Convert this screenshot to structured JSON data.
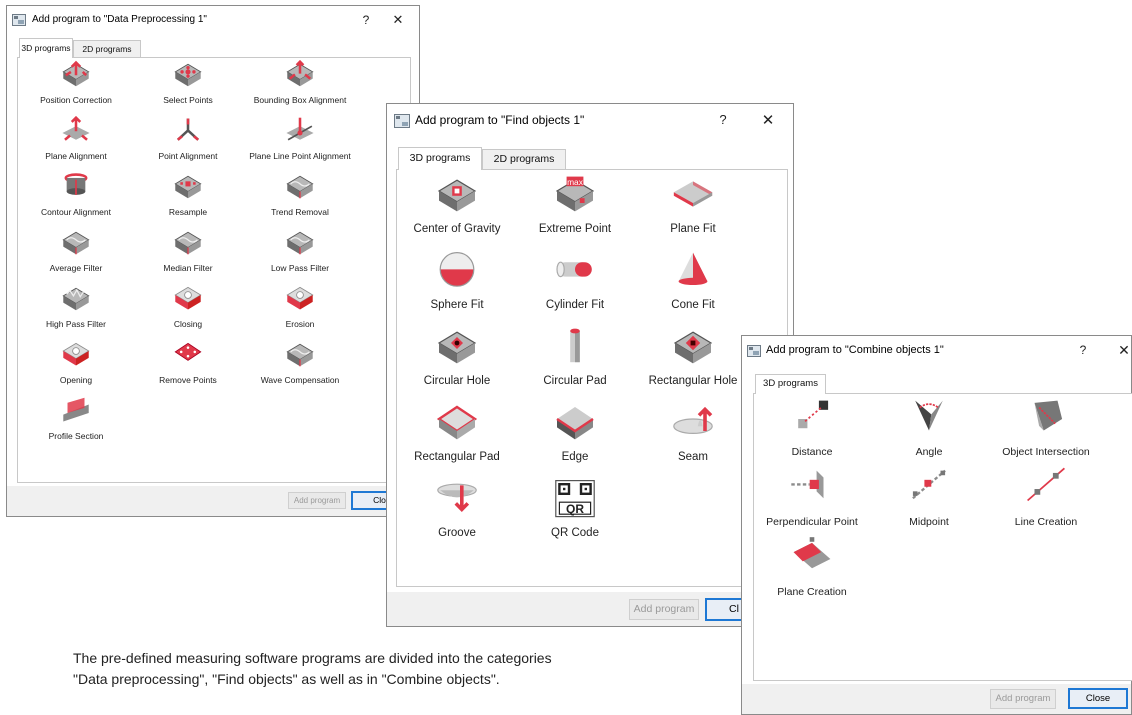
{
  "dialog1": {
    "title": "Add program to \"Data Preprocessing 1\"",
    "help": "?",
    "close_x": "✕",
    "tabs": [
      {
        "label": "3D programs",
        "active": true
      },
      {
        "label": "2D programs",
        "active": false
      }
    ],
    "items": [
      {
        "label": "Position Correction",
        "icon": "position-correction-icon"
      },
      {
        "label": "Select Points",
        "icon": "select-points-icon"
      },
      {
        "label": "Bounding Box Alignment",
        "icon": "bounding-box-alignment-icon"
      },
      {
        "label": "Plane Alignment",
        "icon": "plane-alignment-icon"
      },
      {
        "label": "Point Alignment",
        "icon": "point-alignment-icon"
      },
      {
        "label": "Plane Line Point Alignment",
        "icon": "plane-line-point-alignment-icon"
      },
      {
        "label": "Contour Alignment",
        "icon": "contour-alignment-icon"
      },
      {
        "label": "Resample",
        "icon": "resample-icon"
      },
      {
        "label": "Trend Removal",
        "icon": "trend-removal-icon"
      },
      {
        "label": "Average Filter",
        "icon": "average-filter-icon"
      },
      {
        "label": "Median Filter",
        "icon": "median-filter-icon"
      },
      {
        "label": "Low Pass Filter",
        "icon": "low-pass-filter-icon"
      },
      {
        "label": "High Pass Filter",
        "icon": "high-pass-filter-icon"
      },
      {
        "label": "Closing",
        "icon": "closing-icon"
      },
      {
        "label": "Erosion",
        "icon": "erosion-icon"
      },
      {
        "label": "Opening",
        "icon": "opening-icon"
      },
      {
        "label": "Remove Points",
        "icon": "remove-points-icon"
      },
      {
        "label": "Wave Compensation",
        "icon": "wave-compensation-icon"
      },
      {
        "label": "Profile Section",
        "icon": "profile-section-icon"
      }
    ],
    "add_button": "Add program",
    "close_button": "Close"
  },
  "dialog2": {
    "title": "Add program to \"Find objects 1\"",
    "help": "?",
    "close_x": "✕",
    "tabs": [
      {
        "label": "3D programs",
        "active": true
      },
      {
        "label": "2D programs",
        "active": false
      }
    ],
    "items": [
      {
        "label": "Center of Gravity",
        "icon": "center-of-gravity-icon"
      },
      {
        "label": "Extreme Point",
        "icon": "extreme-point-icon",
        "icon_text": "max"
      },
      {
        "label": "Plane Fit",
        "icon": "plane-fit-icon"
      },
      {
        "label": "Sphere Fit",
        "icon": "sphere-fit-icon"
      },
      {
        "label": "Cylinder Fit",
        "icon": "cylinder-fit-icon"
      },
      {
        "label": "Cone Fit",
        "icon": "cone-fit-icon"
      },
      {
        "label": "Circular Hole",
        "icon": "circular-hole-icon"
      },
      {
        "label": "Circular Pad",
        "icon": "circular-pad-icon"
      },
      {
        "label": "Rectangular Hole",
        "icon": "rectangular-hole-icon"
      },
      {
        "label": "Rectangular Pad",
        "icon": "rectangular-pad-icon"
      },
      {
        "label": "Edge",
        "icon": "edge-icon"
      },
      {
        "label": "Seam",
        "icon": "seam-icon"
      },
      {
        "label": "Groove",
        "icon": "groove-icon"
      },
      {
        "label": "QR Code",
        "icon": "qr-code-icon",
        "icon_text": "QR"
      }
    ],
    "add_button": "Add program",
    "close_button": "Cl"
  },
  "dialog3": {
    "title": "Add program to \"Combine objects 1\"",
    "help": "?",
    "close_x": "✕",
    "tabs": [
      {
        "label": "3D programs",
        "active": true
      }
    ],
    "items": [
      {
        "label": "Distance",
        "icon": "distance-icon"
      },
      {
        "label": "Angle",
        "icon": "angle-icon"
      },
      {
        "label": "Object Intersection",
        "icon": "object-intersection-icon"
      },
      {
        "label": "Perpendicular Point",
        "icon": "perpendicular-point-icon"
      },
      {
        "label": "Midpoint",
        "icon": "midpoint-icon"
      },
      {
        "label": "Line Creation",
        "icon": "line-creation-icon"
      },
      {
        "label": "Plane Creation",
        "icon": "plane-creation-icon"
      }
    ],
    "add_button": "Add program",
    "close_button": "Close"
  },
  "caption": {
    "line1": "The pre-defined measuring software programs are divided into the categories",
    "line2": "\"Data preprocessing\", \"Find objects\" as well as in \"Combine objects\"."
  },
  "colors": {
    "accent_red": "#e0394a",
    "gray": "#8c8c8c",
    "dark_gray": "#555555",
    "focus_blue": "#1e78d4"
  }
}
